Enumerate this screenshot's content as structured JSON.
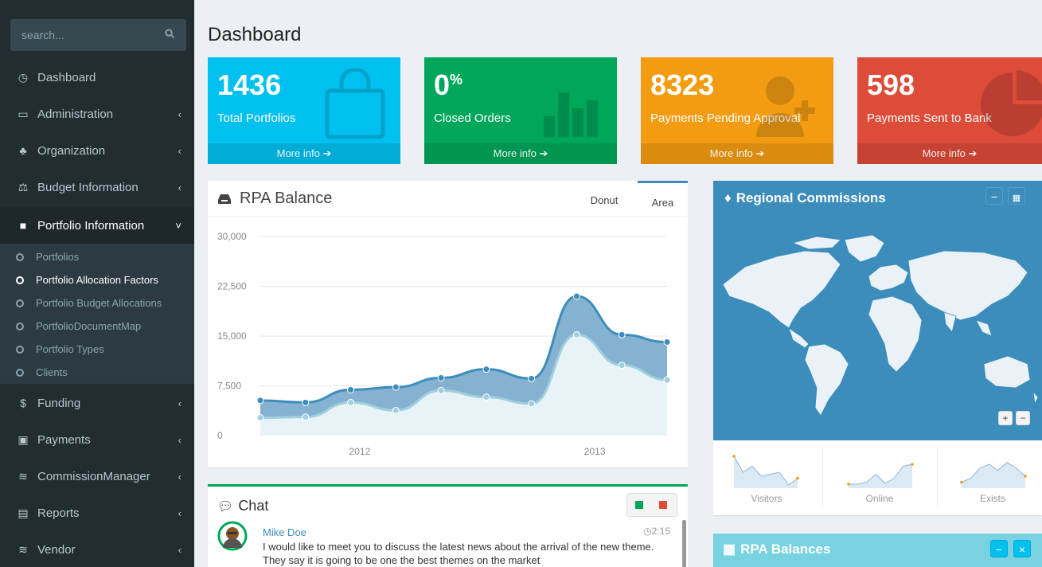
{
  "search": {
    "placeholder": "search..."
  },
  "sidebar": {
    "items": [
      {
        "label": "Dashboard",
        "icon": "dashboard-icon"
      },
      {
        "label": "Administration",
        "icon": "monitor-icon"
      },
      {
        "label": "Organization",
        "icon": "sitemap-icon"
      },
      {
        "label": "Budget Information",
        "icon": "balance-icon"
      },
      {
        "label": "Portfolio Information",
        "icon": "briefcase-icon"
      },
      {
        "label": "Funding",
        "icon": "dollar-icon"
      },
      {
        "label": "Payments",
        "icon": "money-icon"
      },
      {
        "label": "CommissionManager",
        "icon": "layers-icon"
      },
      {
        "label": "Reports",
        "icon": "newspaper-icon"
      },
      {
        "label": "Vendor",
        "icon": "layers-icon"
      }
    ],
    "subitems": [
      {
        "label": "Portfolios"
      },
      {
        "label": "Portfolio Allocation Factors"
      },
      {
        "label": "Portfolio Budget Allocations"
      },
      {
        "label": "PortfolioDocumentMap"
      },
      {
        "label": "Portfolio Types"
      },
      {
        "label": "Clients"
      }
    ]
  },
  "page": {
    "title": "Dashboard"
  },
  "tiles": [
    {
      "value": "1436",
      "suffix": "",
      "label": "Total Portfolios",
      "more": "More info",
      "color": "#00c0ef",
      "icon": "shopping-bag-icon"
    },
    {
      "value": "0",
      "suffix": "%",
      "label": "Closed Orders",
      "more": "More info",
      "color": "#00a65a",
      "icon": "bar-chart-icon"
    },
    {
      "value": "8323",
      "suffix": "",
      "label": "Payments Pending Approval",
      "more": "More info",
      "color": "#f39c12",
      "icon": "user-plus-icon"
    },
    {
      "value": "598",
      "suffix": "",
      "label": "Payments Sent to Bank",
      "more": "More info",
      "color": "#dd4b39",
      "icon": "pie-chart-icon"
    }
  ],
  "rpa": {
    "title": "RPA Balance",
    "tabs": [
      "Donut",
      "Area"
    ],
    "active_tab": "Area"
  },
  "chart_data": {
    "type": "area",
    "title": "RPA Balance",
    "xlabel": "",
    "ylabel": "",
    "ylim": [
      0,
      30000
    ],
    "y_ticks": [
      "30,000",
      "22,500",
      "15,000",
      "7,500",
      "0"
    ],
    "x_ticks": [
      "2012",
      "2013"
    ],
    "series": [
      {
        "values": [
          5300,
          5000,
          6900,
          7300,
          8700,
          10000,
          8600,
          21000,
          15200,
          14100
        ],
        "color": "#3c8dbc"
      },
      {
        "values": [
          2700,
          2800,
          5000,
          3800,
          6800,
          5800,
          4800,
          15200,
          10600,
          8400
        ],
        "color": "#a0d0e0"
      }
    ],
    "grid": true
  },
  "map": {
    "title": "Regional Commissions",
    "sparklines": [
      {
        "label": "Visitors",
        "values": [
          80,
          40,
          55,
          30,
          35,
          40,
          8,
          25
        ]
      },
      {
        "label": "Online",
        "values": [
          10,
          10,
          15,
          35,
          12,
          25,
          55,
          60
        ]
      },
      {
        "label": "Exists",
        "values": [
          15,
          25,
          50,
          60,
          45,
          65,
          50,
          30
        ]
      }
    ]
  },
  "chat": {
    "title": "Chat",
    "messages": [
      {
        "name": "Mike Doe",
        "time": "2:15",
        "text": "I would like to meet you to discuss the latest news about the arrival of the new theme. They say it is going to be one the best themes on the market"
      }
    ]
  },
  "rpa_balances": {
    "title": "RPA Balances"
  }
}
